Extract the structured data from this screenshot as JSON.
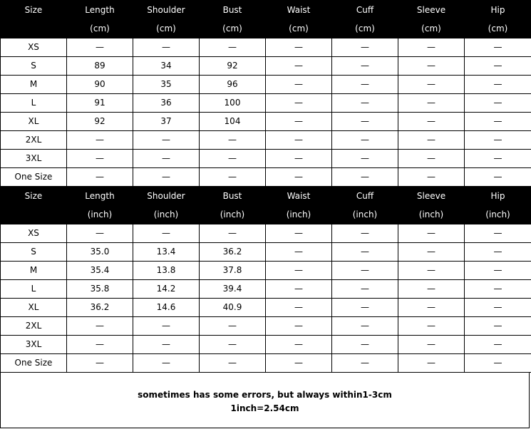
{
  "columns": [
    "Size",
    "Length",
    "Shoulder",
    "Bust",
    "Waist",
    "Cuff",
    "Sleeve",
    "Hip"
  ],
  "tables": [
    {
      "unit": "(cm)",
      "rows": [
        [
          "XS",
          "—",
          "—",
          "—",
          "—",
          "—",
          "—",
          "—"
        ],
        [
          "S",
          "89",
          "34",
          "92",
          "—",
          "—",
          "—",
          "—"
        ],
        [
          "M",
          "90",
          "35",
          "96",
          "—",
          "—",
          "—",
          "—"
        ],
        [
          "L",
          "91",
          "36",
          "100",
          "—",
          "—",
          "—",
          "—"
        ],
        [
          "XL",
          "92",
          "37",
          "104",
          "—",
          "—",
          "—",
          "—"
        ],
        [
          "2XL",
          "—",
          "—",
          "—",
          "—",
          "—",
          "—",
          "—"
        ],
        [
          "3XL",
          "—",
          "—",
          "—",
          "—",
          "—",
          "—",
          "—"
        ],
        [
          "One Size",
          "—",
          "—",
          "—",
          "—",
          "—",
          "—",
          "—"
        ]
      ]
    },
    {
      "unit": "(inch)",
      "rows": [
        [
          "XS",
          "—",
          "—",
          "—",
          "—",
          "—",
          "—",
          "—"
        ],
        [
          "S",
          "35.0",
          "13.4",
          "36.2",
          "—",
          "—",
          "—",
          "—"
        ],
        [
          "M",
          "35.4",
          "13.8",
          "37.8",
          "—",
          "—",
          "—",
          "—"
        ],
        [
          "L",
          "35.8",
          "14.2",
          "39.4",
          "—",
          "—",
          "—",
          "—"
        ],
        [
          "XL",
          "36.2",
          "14.6",
          "40.9",
          "—",
          "—",
          "—",
          "—"
        ],
        [
          "2XL",
          "—",
          "—",
          "—",
          "—",
          "—",
          "—",
          "—"
        ],
        [
          "3XL",
          "—",
          "—",
          "—",
          "—",
          "—",
          "—",
          "—"
        ],
        [
          "One Size",
          "—",
          "—",
          "—",
          "—",
          "—",
          "—",
          "—"
        ]
      ]
    }
  ],
  "note": {
    "line1": "sometimes has some errors, but always within1-3cm",
    "line2": "1inch=2.54cm"
  }
}
